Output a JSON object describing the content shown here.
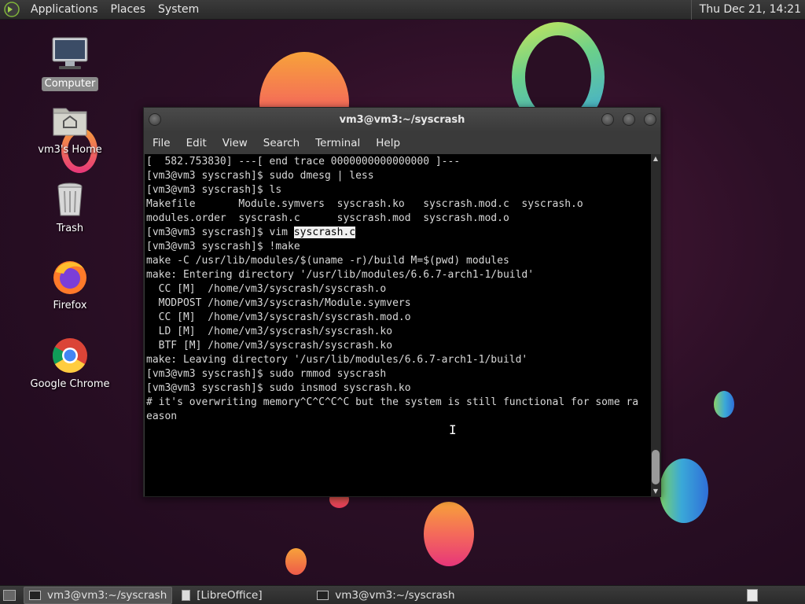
{
  "top_panel": {
    "menus": [
      "Applications",
      "Places",
      "System"
    ],
    "clock": "Thu Dec 21, 14:21"
  },
  "desktop": {
    "icons": [
      {
        "label": "Computer",
        "icon": "computer-icon",
        "selected": true
      },
      {
        "label": "vm3's Home",
        "icon": "home-folder-icon"
      },
      {
        "label": "Trash",
        "icon": "trash-icon"
      },
      {
        "label": "Firefox",
        "icon": "firefox-icon"
      },
      {
        "label": "Google Chrome",
        "icon": "chrome-icon"
      }
    ]
  },
  "terminal": {
    "title": "vm3@vm3:~/syscrash",
    "menu": [
      "File",
      "Edit",
      "View",
      "Search",
      "Terminal",
      "Help"
    ],
    "lines": [
      "[  582.753830] ---[ end trace 0000000000000000 ]---",
      "[vm3@vm3 syscrash]$ sudo dmesg | less",
      "[vm3@vm3 syscrash]$ ls",
      "Makefile       Module.symvers  syscrash.ko   syscrash.mod.c  syscrash.o",
      "modules.order  syscrash.c      syscrash.mod  syscrash.mod.o",
      "[vm3@vm3 syscrash]$ vim ",
      "[vm3@vm3 syscrash]$ !make",
      "make -C /usr/lib/modules/$(uname -r)/build M=$(pwd) modules",
      "make: Entering directory '/usr/lib/modules/6.6.7-arch1-1/build'",
      "  CC [M]  /home/vm3/syscrash/syscrash.o",
      "  MODPOST /home/vm3/syscrash/Module.symvers",
      "  CC [M]  /home/vm3/syscrash/syscrash.mod.o",
      "  LD [M]  /home/vm3/syscrash/syscrash.ko",
      "  BTF [M] /home/vm3/syscrash/syscrash.ko",
      "make: Leaving directory '/usr/lib/modules/6.6.7-arch1-1/build'",
      "[vm3@vm3 syscrash]$ sudo rmmod syscrash",
      "[vm3@vm3 syscrash]$ sudo insmod syscrash.ko",
      "# it's overwriting memory^C^C^C^C but the system is still functional for some ra",
      "eason"
    ],
    "selected_text": "syscrash.c"
  },
  "taskbar": {
    "tasks": [
      {
        "label": "vm3@vm3:~/syscrash",
        "active": true
      },
      {
        "label": "[LibreOffice]",
        "active": false
      },
      {
        "label": "vm3@vm3:~/syscrash",
        "active": false
      }
    ]
  }
}
